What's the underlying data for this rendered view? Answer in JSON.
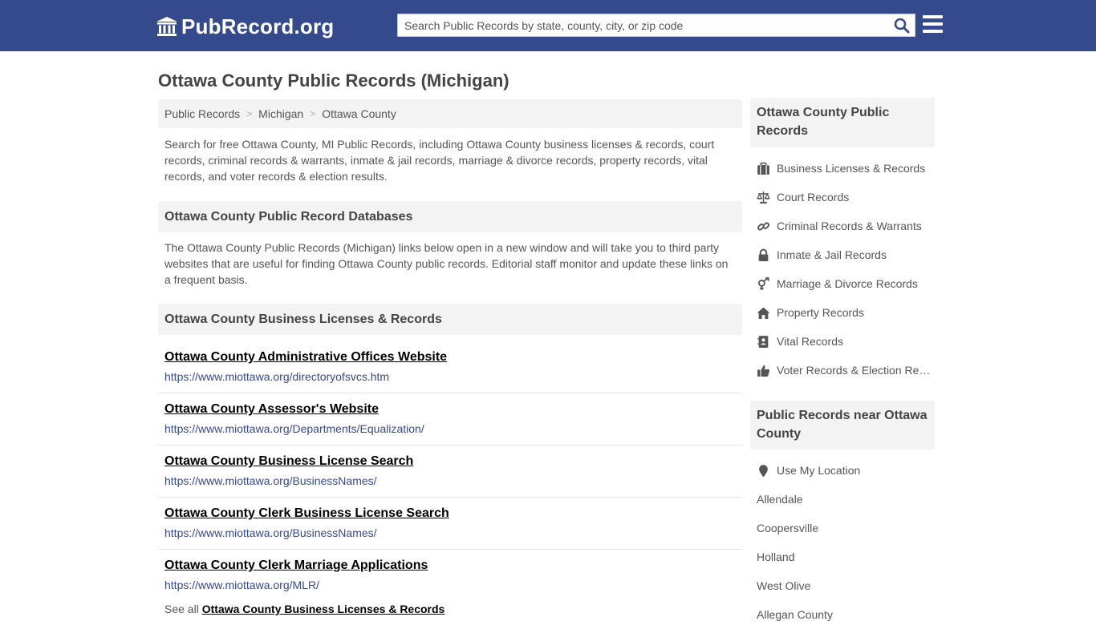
{
  "header": {
    "logo_text": "PubRecord.org",
    "search_placeholder": "Search Public Records by state, county, city, or zip code",
    "search_value": ""
  },
  "page": {
    "title": "Ottawa County Public Records (Michigan)",
    "breadcrumb": [
      "Public Records",
      "Michigan",
      "Ottawa County"
    ],
    "breadcrumb_separator": ">",
    "intro": "Search for free Ottawa County, MI Public Records, including Ottawa County business licenses & records, court records, criminal records & warrants, inmate & jail records, marriage & divorce records, property records, vital records, and voter records & election results."
  },
  "databases": {
    "heading": "Ottawa County Public Record Databases",
    "text": "The Ottawa County Public Records (Michigan) links below open in a new window and will take you to third party websites that are useful for finding Ottawa County public records. Editorial staff monitor and update these links on a frequent basis."
  },
  "business": {
    "heading": "Ottawa County Business Licenses & Records",
    "records": [
      {
        "title": "Ottawa County Administrative Offices Website",
        "url": "https://www.miottawa.org/directoryofsvcs.htm"
      },
      {
        "title": "Ottawa County Assessor's Website",
        "url": "https://www.miottawa.org/Departments/Equalization/"
      },
      {
        "title": "Ottawa County Business License Search",
        "url": "https://www.miottawa.org/BusinessNames/"
      },
      {
        "title": "Ottawa County Clerk Business License Search",
        "url": "https://www.miottawa.org/BusinessNames/"
      },
      {
        "title": "Ottawa County Clerk Marriage Applications",
        "url": "https://www.miottawa.org/MLR/"
      }
    ],
    "see_all_prefix": "See all",
    "see_all_link": "Ottawa County Business Licenses & Records"
  },
  "sidebar": {
    "records_heading": "Ottawa County Public Records",
    "records_links": [
      {
        "label": "Business Licenses & Records",
        "icon": "briefcase-icon"
      },
      {
        "label": "Court Records",
        "icon": "scales-icon"
      },
      {
        "label": "Criminal Records & Warrants",
        "icon": "link-icon"
      },
      {
        "label": "Inmate & Jail Records",
        "icon": "lock-icon"
      },
      {
        "label": "Marriage & Divorce Records",
        "icon": "gender-icon"
      },
      {
        "label": "Property Records",
        "icon": "home-icon"
      },
      {
        "label": "Vital Records",
        "icon": "contact-book-icon"
      },
      {
        "label": "Voter Records & Election Results",
        "icon": "thumbs-up-icon"
      }
    ],
    "nearby_heading": "Public Records near Ottawa County",
    "nearby_links": [
      {
        "label": "Use My Location",
        "icon": "map-pin-icon"
      },
      {
        "label": "Allendale"
      },
      {
        "label": "Coopersville"
      },
      {
        "label": "Holland"
      },
      {
        "label": "West Olive"
      },
      {
        "label": "Allegan County"
      }
    ]
  },
  "colors": {
    "header_bg": "#354a8c",
    "panel_bg": "#f3f3f3",
    "link_url": "#354a8c",
    "search_icon": "#354a8c"
  }
}
